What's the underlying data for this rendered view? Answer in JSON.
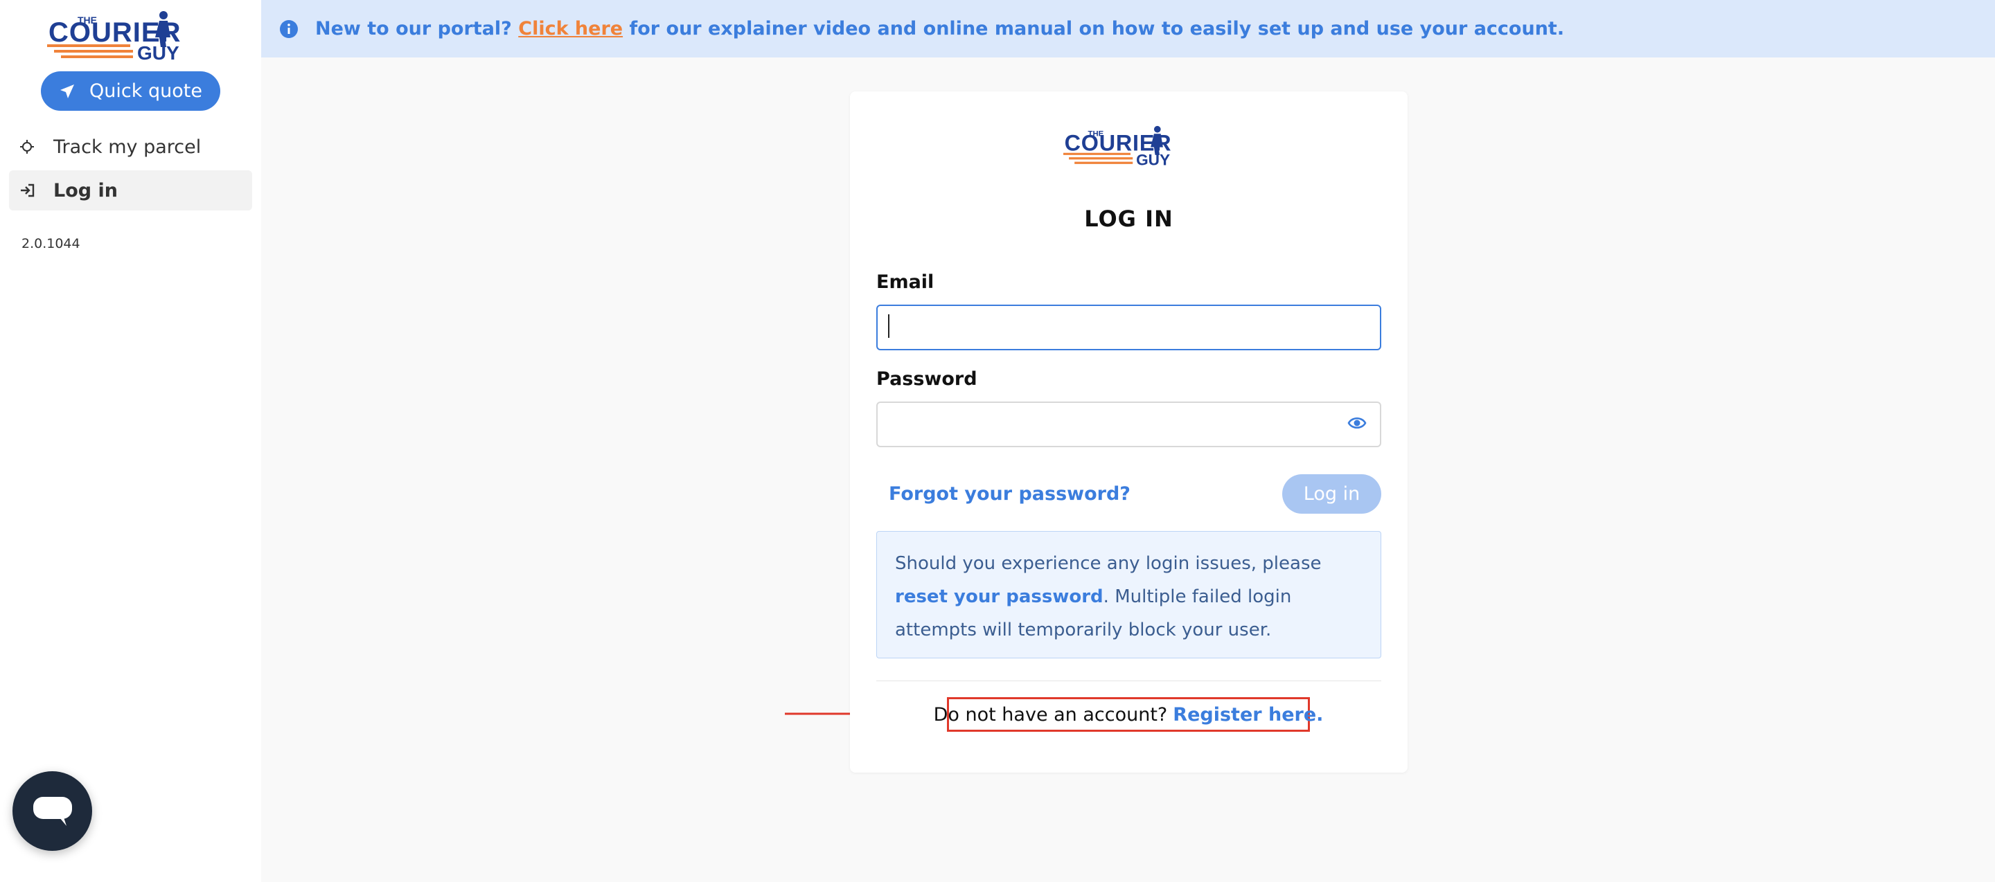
{
  "sidebar": {
    "logo_alt": "The Courier Guy",
    "quick_quote_label": "Quick quote",
    "items": [
      {
        "label": "Track my parcel",
        "icon": "crosshair-icon"
      },
      {
        "label": "Log in",
        "icon": "login-icon",
        "active": true
      }
    ],
    "version": "2.0.1044"
  },
  "banner": {
    "lead": "New to our portal?",
    "link": "Click here",
    "rest": "for our explainer video and online manual on how to easily set up and use your account."
  },
  "login": {
    "title": "LOG IN",
    "email_label": "Email",
    "email_value": "",
    "password_label": "Password",
    "password_value": "",
    "forgot_label": "Forgot your password?",
    "login_button": "Log in",
    "notice_pre": "Should you experience any login issues, please",
    "notice_link": "reset your password",
    "notice_post": ". Multiple failed login attempts will temporarily block your user.",
    "register_prompt": "Do not have an account?",
    "register_link": "Register here."
  },
  "colors": {
    "accent": "#3b7ddd",
    "banner_bg": "#dbe8fb",
    "link_orange": "#f0833a",
    "highlight_red": "#e0392b",
    "chat_bg": "#1e2a3b"
  }
}
